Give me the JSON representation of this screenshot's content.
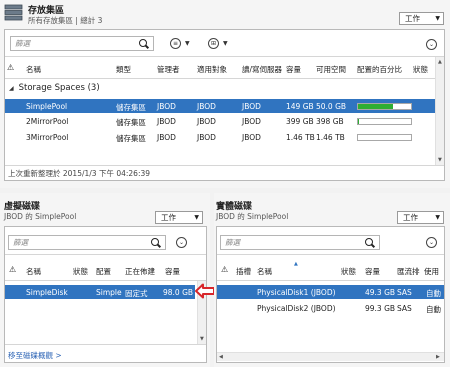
{
  "pool_panel": {
    "title": "存放集區",
    "subtitle": "所有存放集區 | 總計 3",
    "tasks_label": "工作",
    "search_placeholder": "篩選",
    "columns": [
      "名稱",
      "類型",
      "管理者",
      "適用對象",
      "讀/寫伺服器",
      "容量",
      "可用空間",
      "配置的百分比",
      "狀態"
    ],
    "group_label": "Storage Spaces (3)",
    "rows": [
      {
        "name": "SimplePool",
        "type": "儲存集區",
        "manager": "JBOD",
        "target": "JBOD",
        "server": "JBOD",
        "capacity": "149 GB",
        "free": "50.0 GB",
        "percent": 0.66,
        "selected": true
      },
      {
        "name": "2MirrorPool",
        "type": "儲存集區",
        "manager": "JBOD",
        "target": "JBOD",
        "server": "JBOD",
        "capacity": "399 GB",
        "free": "398 GB",
        "percent": 0.01,
        "selected": false
      },
      {
        "name": "3MirrorPool",
        "type": "儲存集區",
        "manager": "JBOD",
        "target": "JBOD",
        "server": "JBOD",
        "capacity": "1.46 TB",
        "free": "1.46 TB",
        "percent": 0.0,
        "selected": false
      }
    ],
    "status_text": "上次重新整理於 2015/1/3 下午 04:26:39"
  },
  "vdisk_panel": {
    "title": "虛擬磁碟",
    "subtitle": "JBOD 的 SimplePool",
    "tasks_label": "工作",
    "search_placeholder": "篩選",
    "columns": [
      "名稱",
      "狀態",
      "配置",
      "正在佈建",
      "容量"
    ],
    "rows": [
      {
        "name": "SimpleDisk",
        "status": "",
        "layout": "Simple",
        "provisioning": "固定式",
        "capacity": "98.0 GB",
        "selected": true
      }
    ],
    "footer_link": "移至磁碟概觀 >"
  },
  "pdisk_panel": {
    "title": "實體磁碟",
    "subtitle": "JBOD 的 SimplePool",
    "tasks_label": "工作",
    "search_placeholder": "篩選",
    "columns": [
      "插槽",
      "名稱",
      "狀態",
      "容量",
      "匯流排",
      "使用"
    ],
    "rows": [
      {
        "name": "PhysicalDisk1 (JBOD)",
        "capacity": "49.3 GB",
        "bus": "SAS",
        "usage": "自動",
        "selected": true
      },
      {
        "name": "PhysicalDisk2 (JBOD)",
        "capacity": "99.3 GB",
        "bus": "SAS",
        "usage": "自動",
        "selected": false
      }
    ]
  },
  "colors": {
    "selection": "#3074c0",
    "progress": "#2fae32",
    "callout_arrow": "#d8262a"
  }
}
